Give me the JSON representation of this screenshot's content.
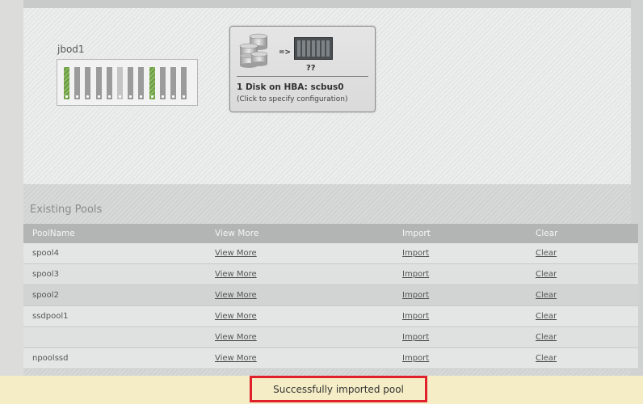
{
  "enclosure": {
    "name": "jbod1",
    "bays": [
      {
        "state": "active"
      },
      {
        "state": "empty"
      },
      {
        "state": "empty"
      },
      {
        "state": "empty"
      },
      {
        "state": "empty"
      },
      {
        "state": "light"
      },
      {
        "state": "empty"
      },
      {
        "state": "empty"
      },
      {
        "state": "active"
      },
      {
        "state": "empty"
      },
      {
        "state": "empty"
      },
      {
        "state": "empty"
      }
    ]
  },
  "hba_card": {
    "arrow": "=>",
    "unknown_label": "??",
    "title": "1 Disk on HBA: scbus0",
    "subtitle": "(Click to specify configuration)"
  },
  "existing_pools": {
    "title": "Existing Pools",
    "columns": [
      "PoolName",
      "View More",
      "Import",
      "Clear"
    ],
    "rows": [
      {
        "name": "spool4",
        "view_more": "View More",
        "import": "Import",
        "clear": "Clear"
      },
      {
        "name": "spool3",
        "view_more": "View More",
        "import": "Import",
        "clear": "Clear"
      },
      {
        "name": "spool2",
        "view_more": "View More",
        "import": "Import",
        "clear": "Clear"
      },
      {
        "name": "ssdpool1",
        "view_more": "View More",
        "import": "Import",
        "clear": "Clear"
      },
      {
        "name": "",
        "view_more": "View More",
        "import": "Import",
        "clear": "Clear"
      },
      {
        "name": "npoolssd",
        "view_more": "View More",
        "import": "Import",
        "clear": "Clear"
      }
    ]
  },
  "notification": {
    "message": "Successfully imported pool"
  },
  "colors": {
    "active_bay": "#8aba5e",
    "notification_bg": "#f5edc6",
    "notification_border": "#e0202a"
  }
}
